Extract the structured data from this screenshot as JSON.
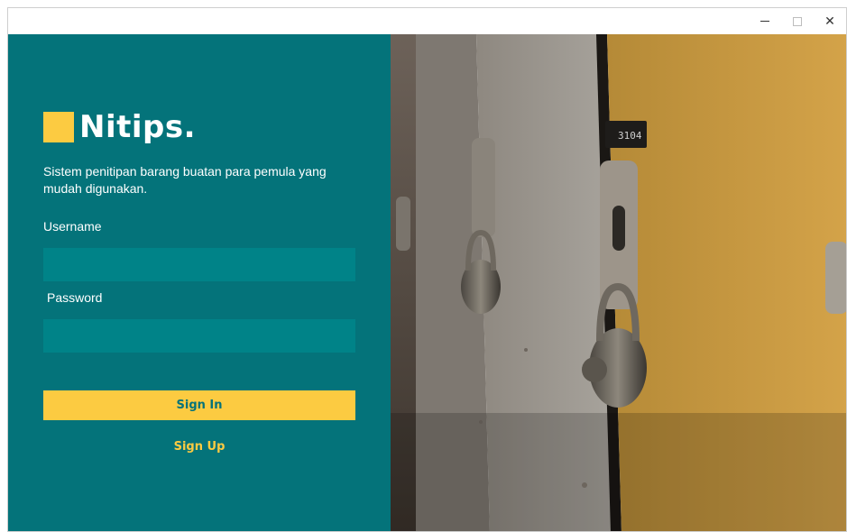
{
  "window": {
    "minimize_glyph": "–",
    "maximize_glyph": "□",
    "close_glyph": "✕"
  },
  "brand": {
    "name": "Nitips.",
    "tagline": "Sistem penitipan barang buatan para pemula yang mudah digunakan.",
    "accent_color": "#fccb41",
    "panel_color": "#04737a"
  },
  "form": {
    "username_label": "Username",
    "username_value": "",
    "password_label": "Password",
    "password_value": "",
    "signin_label": "Sign In",
    "signup_label": "Sign Up"
  },
  "photo": {
    "locker_tag": "3104"
  }
}
